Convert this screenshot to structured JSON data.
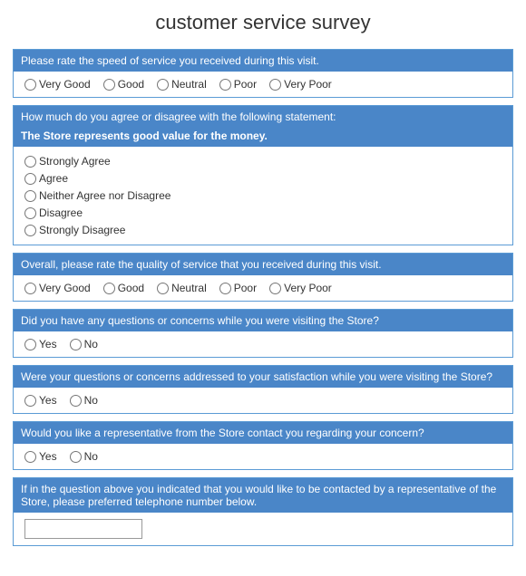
{
  "title": "customer service survey",
  "questions": [
    {
      "id": "q1",
      "header": "Please rate the speed of service you received during this visit.",
      "subheader": null,
      "type": "radio-row",
      "options": [
        "Very Good",
        "Good",
        "Neutral",
        "Poor",
        "Very Poor"
      ]
    },
    {
      "id": "q2",
      "header": "How much do you agree or disagree with the following statement:",
      "subheader": "The Store represents good value for the money.",
      "type": "radio-col",
      "options": [
        "Strongly Agree",
        "Agree",
        "Neither Agree nor Disagree",
        "Disagree",
        "Strongly Disagree"
      ]
    },
    {
      "id": "q3",
      "header": "Overall, please rate the quality of service that you received during this visit.",
      "subheader": null,
      "type": "radio-row",
      "options": [
        "Very Good",
        "Good",
        "Neutral",
        "Poor",
        "Very Poor"
      ]
    },
    {
      "id": "q4",
      "header": "Did you have any questions or concerns while you were visiting the Store?",
      "subheader": null,
      "type": "radio-row",
      "options": [
        "Yes",
        "No"
      ]
    },
    {
      "id": "q5",
      "header": "Were your questions or concerns addressed to your satisfaction while you were visiting the Store?",
      "subheader": null,
      "type": "radio-row",
      "options": [
        "Yes",
        "No"
      ]
    },
    {
      "id": "q6",
      "header": "Would you like a representative from the Store contact you regarding your concern?",
      "subheader": null,
      "type": "radio-row",
      "options": [
        "Yes",
        "No"
      ]
    },
    {
      "id": "q7",
      "header": "If in the question above you indicated that you would like to be contacted by a representative of the Store, please preferred telephone number below.",
      "subheader": null,
      "type": "text",
      "placeholder": ""
    }
  ]
}
